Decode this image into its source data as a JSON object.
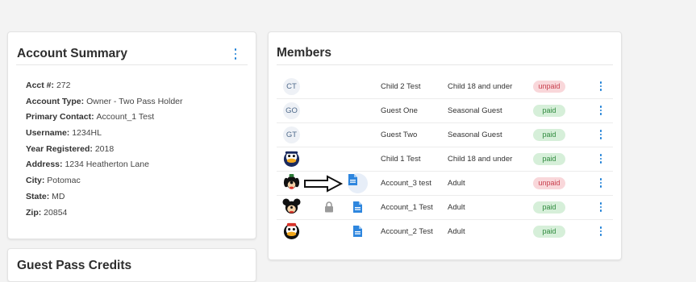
{
  "account_summary": {
    "title": "Account Summary",
    "fields": [
      {
        "label": "Acct #",
        "value": "272"
      },
      {
        "label": "Account Type",
        "value": "Owner - Two Pass Holder"
      },
      {
        "label": "Primary Contact",
        "value": "Account_1 Test"
      },
      {
        "label": "Username",
        "value": "1234HL"
      },
      {
        "label": "Year Registered",
        "value": "2018"
      },
      {
        "label": "Address",
        "value": "1234 Heatherton Lane"
      },
      {
        "label": "City",
        "value": "Potomac"
      },
      {
        "label": "State",
        "value": "MD"
      },
      {
        "label": "Zip",
        "value": "20854"
      }
    ]
  },
  "members": {
    "title": "Members",
    "rows": [
      {
        "initials": "CT",
        "name": "Child 2 Test",
        "type": "Child 18 and under",
        "status": "unpaid"
      },
      {
        "initials": "GO",
        "name": "Guest One",
        "type": "Seasonal Guest",
        "status": "paid"
      },
      {
        "initials": "GT",
        "name": "Guest Two",
        "type": "Seasonal Guest",
        "status": "paid"
      },
      {
        "avatar": "duck-avatar-icon",
        "name": "Child 1 Test",
        "type": "Child 18 and under",
        "status": "paid"
      },
      {
        "avatar": "dog-avatar-icon",
        "name": "Account_3 test",
        "type": "Adult",
        "status": "unpaid",
        "document": "document-icon"
      },
      {
        "avatar": "mouse-avatar-icon",
        "name": "Account_1 Test",
        "type": "Adult",
        "status": "paid",
        "lock": "lock-icon",
        "document": "document-icon"
      },
      {
        "avatar": "duck-avatar-icon",
        "name": "Account_2 Test",
        "type": "Adult",
        "status": "paid",
        "document": "document-icon"
      }
    ]
  },
  "guest_pass_credits": {
    "title": "Guest Pass Credits"
  },
  "colors": {
    "accent": "#1d7fd6",
    "paid_bg": "#d6efd9",
    "paid_text": "#2f8a3e",
    "unpaid_bg": "#f9d7da",
    "unpaid_text": "#c8414f"
  }
}
